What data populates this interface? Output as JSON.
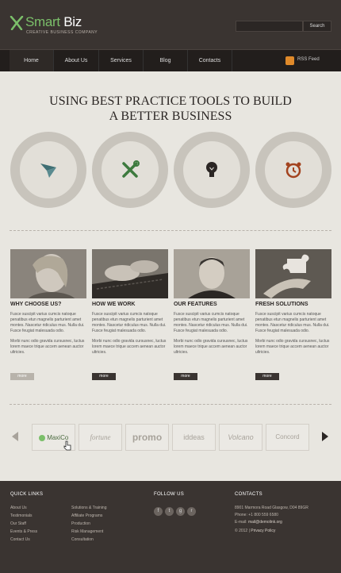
{
  "header": {
    "logo_name_prefix": "Smart",
    "logo_name_suffix": " Biz",
    "tagline": "CREATIVE BUSINESS COMPANY",
    "search_placeholder": "",
    "search_button": "Search"
  },
  "nav": {
    "items": [
      "Home",
      "About Us",
      "Services",
      "Blog",
      "Contacts"
    ],
    "active_index": 0,
    "rss_label": "RSS Feed"
  },
  "hero": {
    "title_line1": "USING BEST PRACTICE TOOLS TO BUILD",
    "title_line2": "A BETTER BUSINESS",
    "icons": [
      "paper-plane-icon",
      "tools-icon",
      "light-bulb-icon",
      "alarm-clock-icon"
    ]
  },
  "features": [
    {
      "title": "WHY CHOOSE US?",
      "text1": "Fusce suscipit varius cumcis natoque penatibus etun magnelis parturient amet montes. Nascetur ridiculus mus. Nulla dui. Fusce feugiat malesuada odio.",
      "text2": "Morbi nunc odio gravida cursusnec, luctus lorem maece trique accem aenean auctor ultricies.",
      "button": "more",
      "image": "smiling-woman-photo"
    },
    {
      "title": "HOW WE WORK",
      "text1": "Fusce suscipit varius cumcis natoque penatibus etun magnelis parturient amet montes. Nascetur ridiculus mus. Nulla dui. Fusce feugiat malesuada odio.",
      "text2": "Morbi nunc odio gravida cursusnec, luctus lorem maece trique accem aenean auctor ultricies.",
      "button": "more",
      "image": "typing-hands-photo"
    },
    {
      "title": "OUR FEATURES",
      "text1": "Fusce suscipit varius cumcis natoque penatibus etun magnelis parturient amet montes. Nascetur ridiculus mus. Nulla dui. Fusce feugiat malesuada odio.",
      "text2": "Morbi nunc odio gravida cursusnec, luctus lorem maece trique accem aenean auctor ultricies.",
      "button": "more",
      "image": "smiling-man-photo"
    },
    {
      "title": "FRESH SOLUTIONS",
      "text1": "Fusce suscipit varius cumcis natoque penatibus etun magnelis parturient amet montes. Nascetur ridiculus mus. Nulla dui. Fusce feugiat malesuada odio.",
      "text2": "Morbi nunc odio gravida cursusnec, luctus lorem maece trique accem aenean auctor ultricies.",
      "button": "more",
      "image": "puzzle-piece-photo"
    }
  ],
  "partners": [
    "MaxiCo",
    "fortune",
    "promo",
    "iddeas",
    "Volcano",
    "Concord"
  ],
  "footer": {
    "quick_links_title": "QUICK LINKS",
    "links_col1": [
      "About Us",
      "Testimonials",
      "Our Staff",
      "Events & Press",
      "Contact Us"
    ],
    "links_col2": [
      "Solutions & Training",
      "Affiliate Programs",
      "Production",
      "Risk Management",
      "Consultation"
    ],
    "follow_title": "FOLLOW US",
    "social": [
      "f",
      "t",
      "g",
      "r"
    ],
    "contacts_title": "CONTACTS",
    "address": "8901 Marmora Road Glasgow, D04 89GR",
    "phone": "Phone: +1 800 559 6580",
    "email_label": "E-mail:",
    "email": "mail@demolink.org",
    "copyright": "© 2012 |",
    "privacy": "Privacy Policy"
  },
  "colors": {
    "header_bg": "#3a3431",
    "nav_bg": "#221e1c",
    "body_bg": "#e8e6e0",
    "accent_green": "#7bbf6a",
    "icon_teal": "#3f6f74",
    "icon_green": "#3d7a3e",
    "icon_red": "#a3431f"
  }
}
